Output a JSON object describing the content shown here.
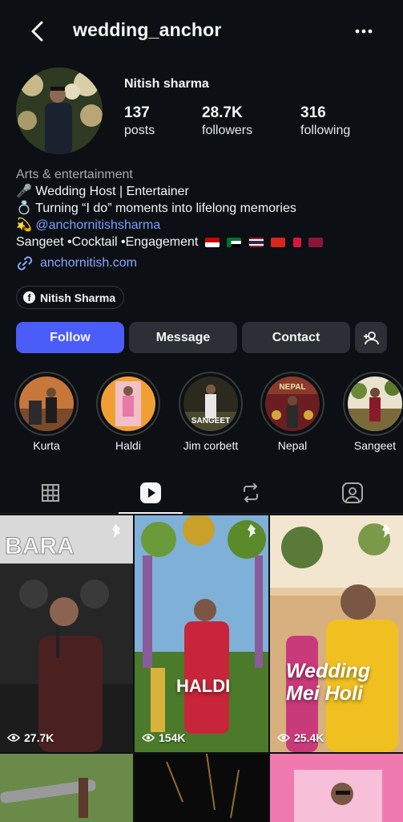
{
  "header": {
    "username": "wedding_anchor"
  },
  "profile": {
    "full_name": "Nitish sharma",
    "stats": [
      {
        "value": "137",
        "label": "posts"
      },
      {
        "value": "28.7K",
        "label": "followers"
      },
      {
        "value": "316",
        "label": "following"
      }
    ],
    "category": "Arts & entertainment",
    "bio_lines": [
      "🎤 Wedding Host | Entertainer",
      "💍 Turning “I do” moments into lifelong memories",
      "💫 @anchornitishsharma",
      "Sangeet •Cocktail •Engagement"
    ],
    "link": "anchornitish.com",
    "facebook_chip": "Nitish Sharma"
  },
  "actions": {
    "follow": "Follow",
    "message": "Message",
    "contact": "Contact"
  },
  "highlights": [
    {
      "label": "Kurta"
    },
    {
      "label": "Haldi"
    },
    {
      "label": "Jim corbett"
    },
    {
      "label": "Nepal"
    },
    {
      "label": "Sangeet"
    }
  ],
  "highlight_overlays": {
    "jim": "SANGEET",
    "nepal": "NEPAL"
  },
  "reels": [
    {
      "views": "27.7K",
      "overlay": ""
    },
    {
      "views": "154K",
      "overlay": "HALDI"
    },
    {
      "views": "25.4K",
      "overlay": "Wedding Mei Holi"
    }
  ],
  "colors": {
    "background": "#0c1014",
    "follow_button": "#4a5df9",
    "secondary_button": "#2c3036",
    "link": "#8aa6ff"
  },
  "icons": {
    "back": "chevron-left-icon",
    "more": "more-horizontal-icon",
    "link": "link-icon",
    "facebook": "facebook-icon",
    "add_person": "add-person-icon",
    "grid_tab": "grid-icon",
    "reels_tab": "reels-icon",
    "reposts_tab": "repost-icon",
    "tagged_tab": "tagged-icon",
    "views": "eye-icon",
    "pinned": "pin-icon"
  }
}
